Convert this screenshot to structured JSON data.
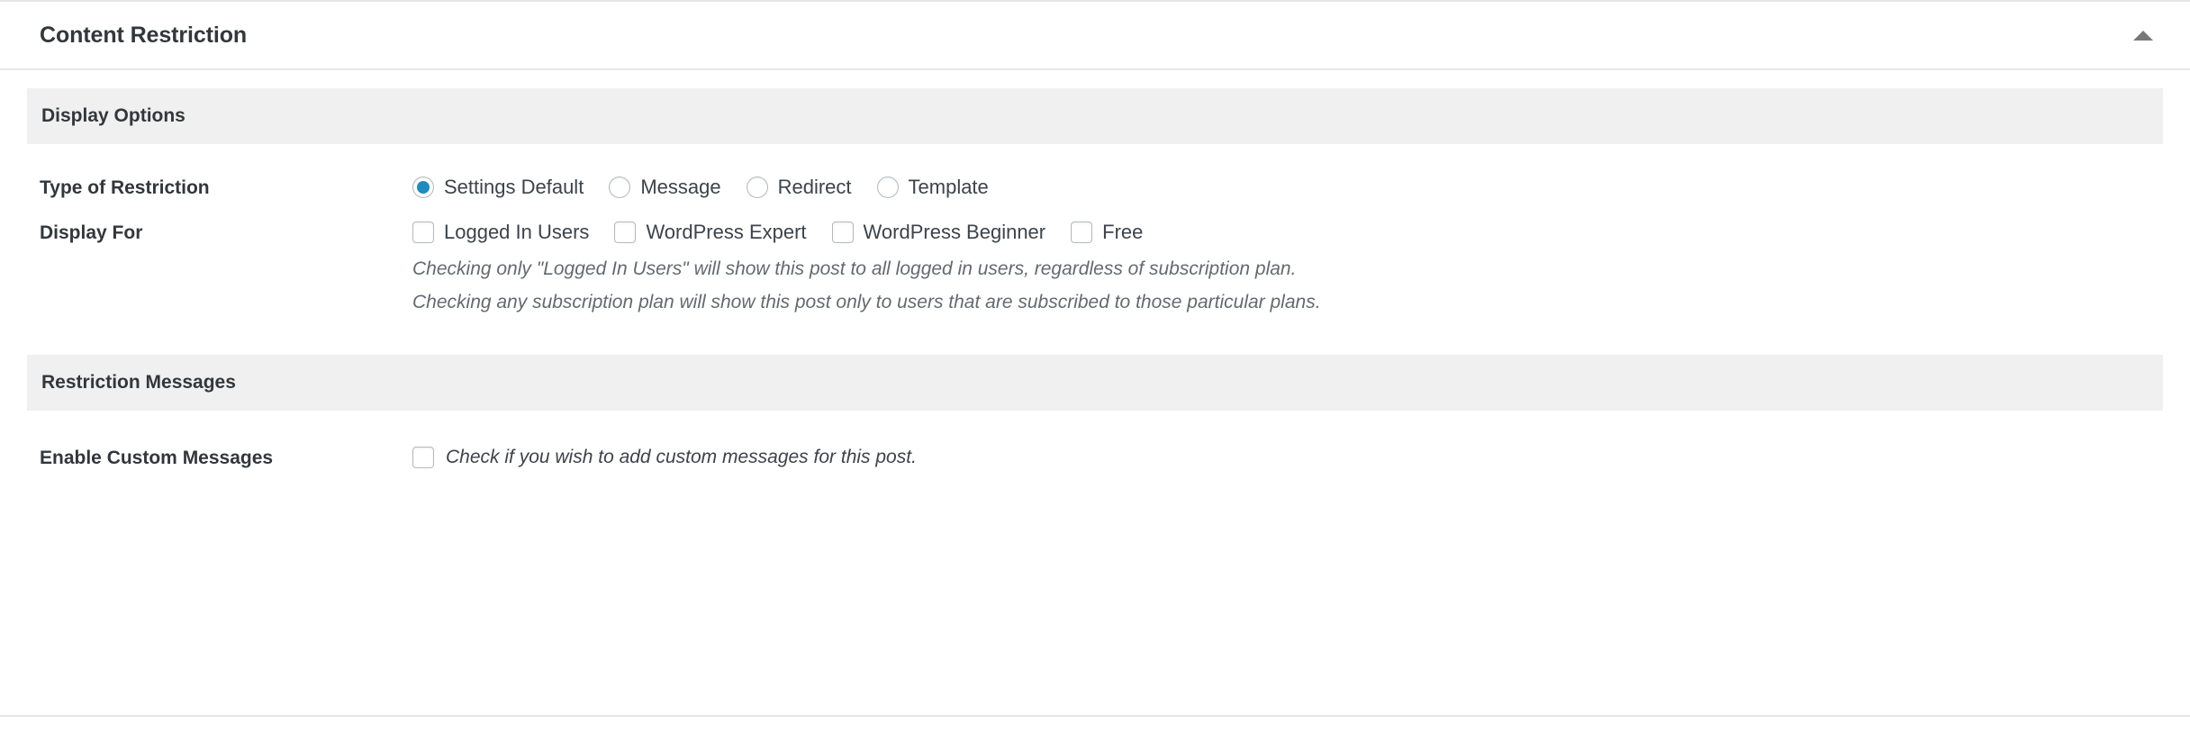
{
  "panel": {
    "title": "Content Restriction",
    "toggle_icon": "caret-up-icon"
  },
  "sections": {
    "display_options": {
      "heading": "Display Options",
      "type_of_restriction": {
        "label": "Type of Restriction",
        "options": [
          {
            "label": "Settings Default",
            "checked": true
          },
          {
            "label": "Message",
            "checked": false
          },
          {
            "label": "Redirect",
            "checked": false
          },
          {
            "label": "Template",
            "checked": false
          }
        ]
      },
      "display_for": {
        "label": "Display For",
        "options": [
          {
            "label": "Logged In Users",
            "checked": false
          },
          {
            "label": "WordPress Expert",
            "checked": false
          },
          {
            "label": "WordPress Beginner",
            "checked": false
          },
          {
            "label": "Free",
            "checked": false
          }
        ],
        "help_line_1": "Checking only \"Logged In Users\" will show this post to all logged in users, regardless of subscription plan.",
        "help_line_2": "Checking any subscription plan will show this post only to users that are subscribed to those particular plans."
      }
    },
    "restriction_messages": {
      "heading": "Restriction Messages",
      "enable_custom_messages": {
        "label": "Enable Custom Messages",
        "checked": false,
        "inline_help": "Check if you wish to add custom messages for this post."
      }
    }
  },
  "colors": {
    "accent": "#1e8cbe",
    "section_bar_bg": "#f0f0f0",
    "border": "#e6e6e6",
    "text": "#32373c",
    "help_text": "#646970"
  }
}
